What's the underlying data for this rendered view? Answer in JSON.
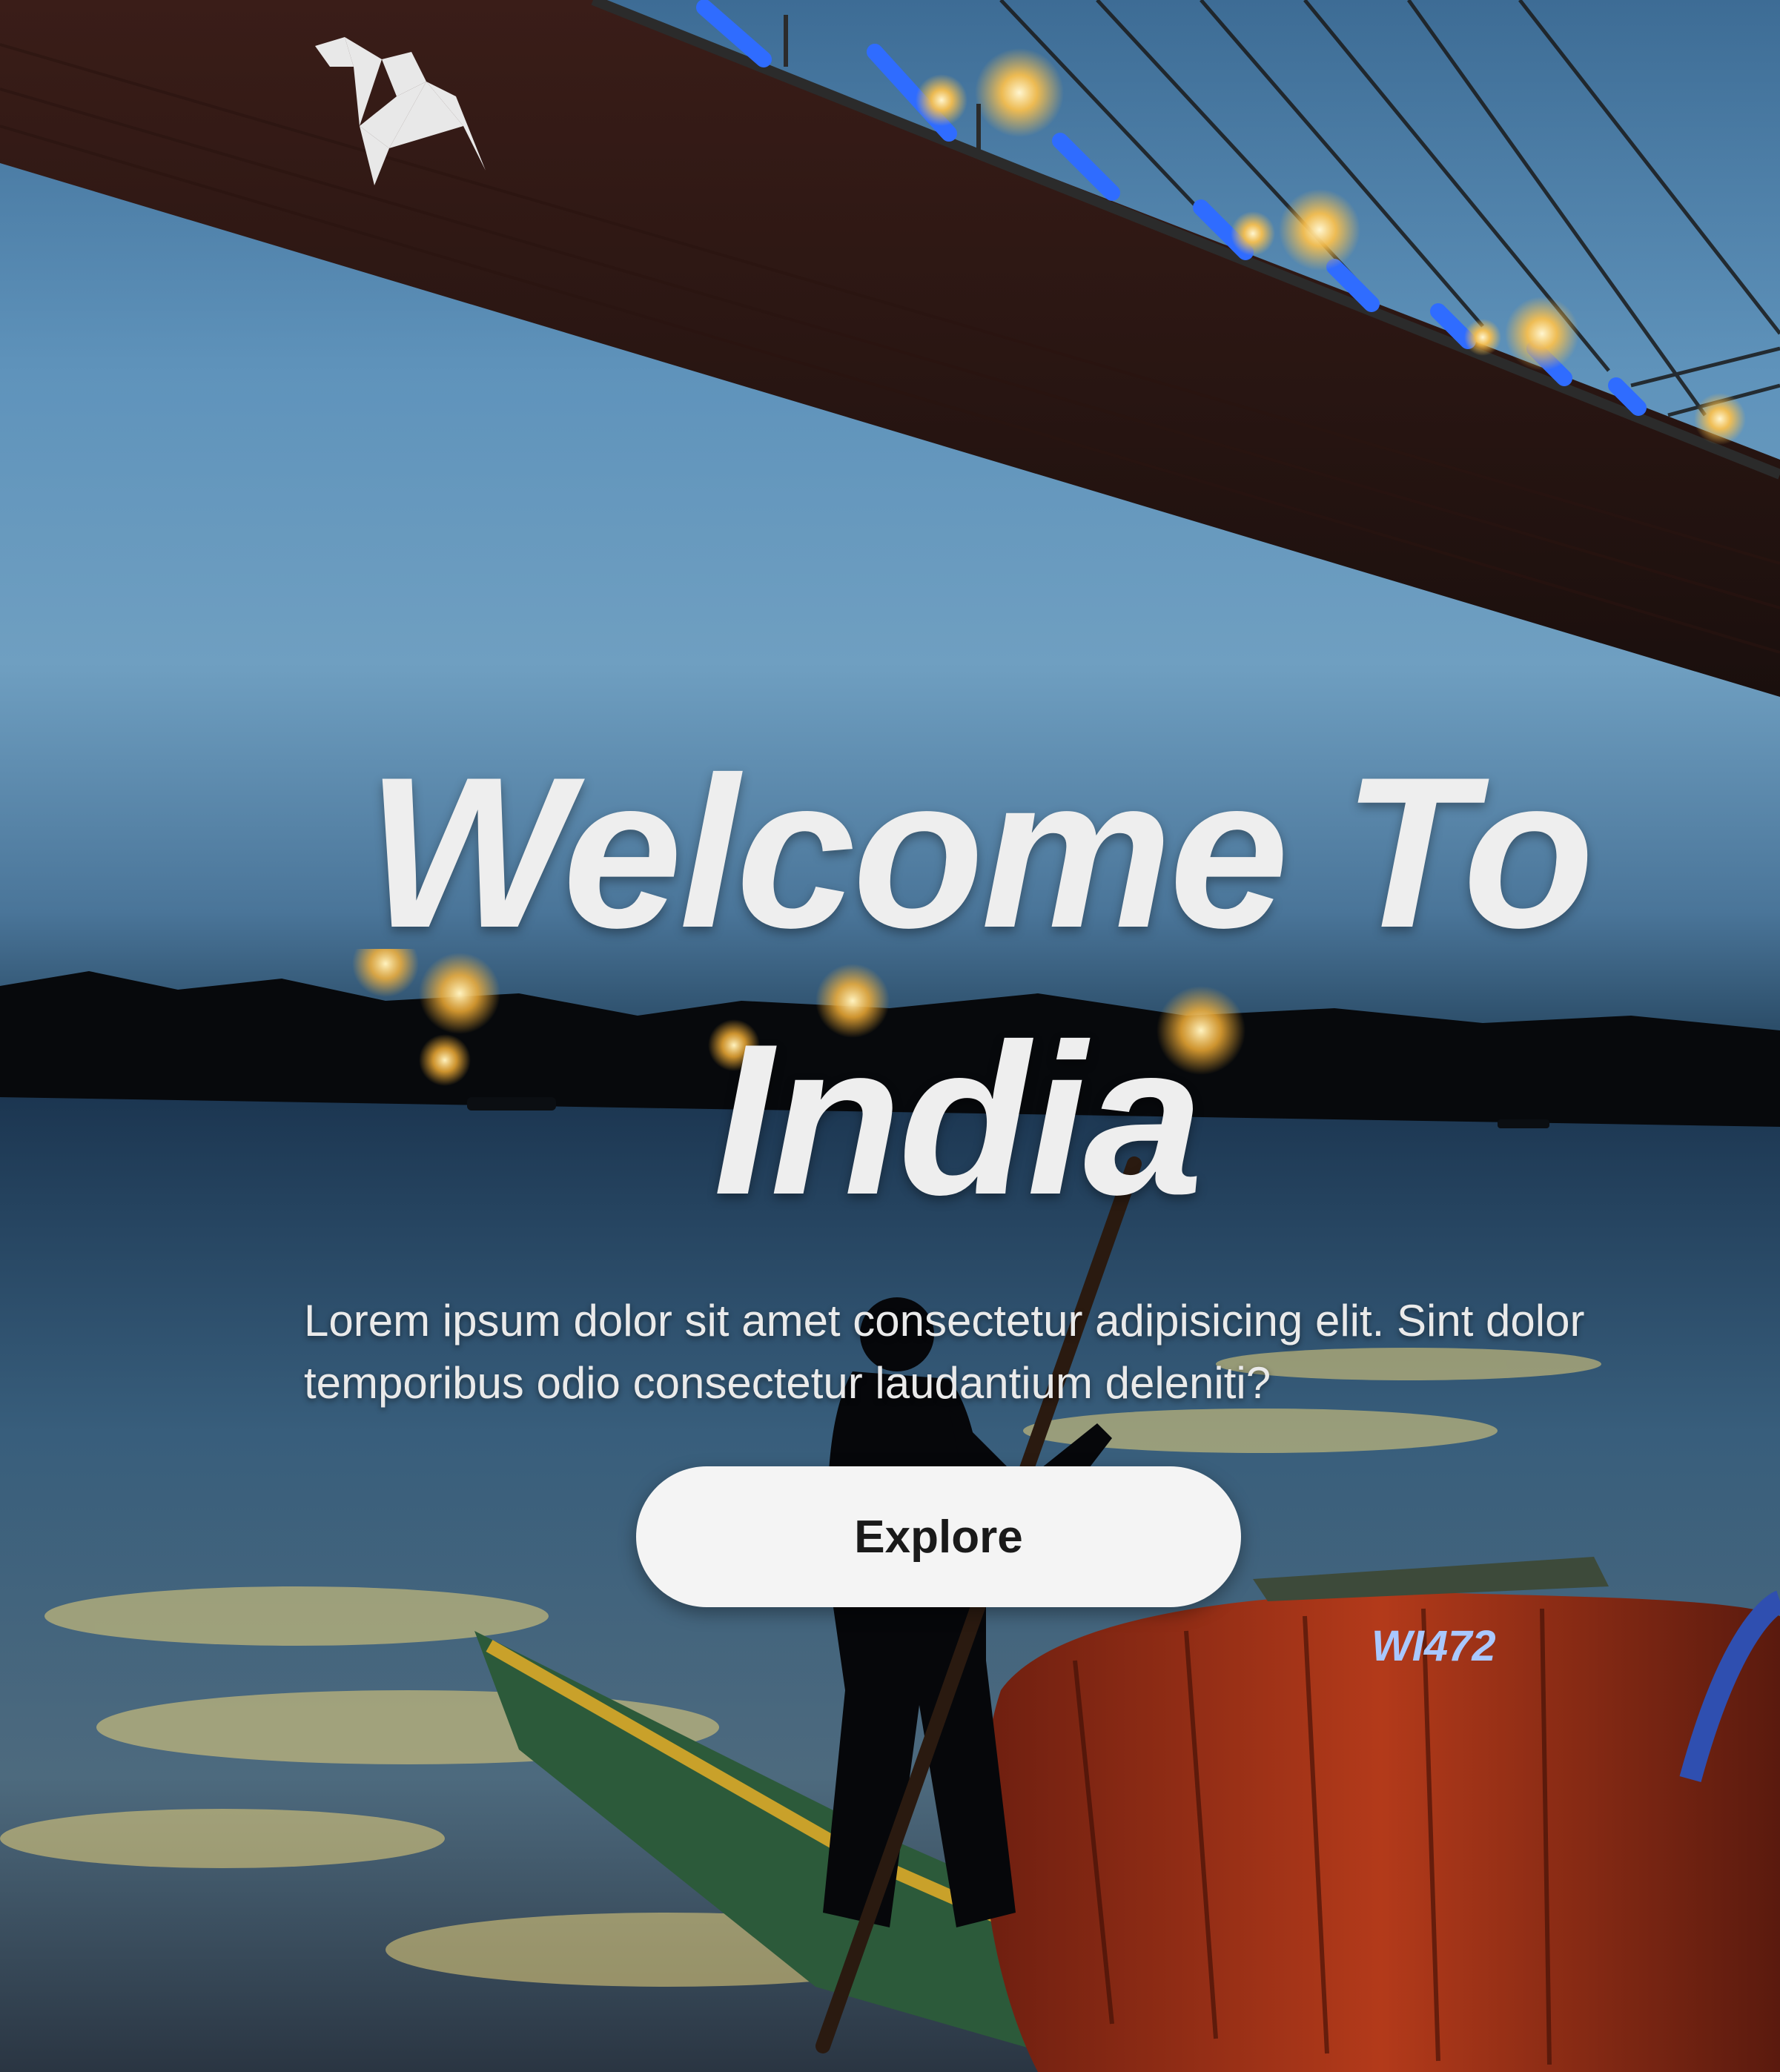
{
  "logo": {
    "icon": "origami-bird-logo-icon"
  },
  "hero": {
    "headline_line1": "Welcome To",
    "headline_line2": "India",
    "subtitle": "Lorem ipsum dolor sit amet consectetur adipisicing elit. Sint dolor temporibus odio consectetur laudantium deleniti?",
    "cta_label": "Explore"
  },
  "background": {
    "boat_marking": "WI472"
  },
  "colors": {
    "text": "#eeeeee",
    "button_bg": "#f4f4f4",
    "button_text": "#1a1a1a",
    "bridge_light_blue": "#2f6cff",
    "lamp_glow": "#ffc24a"
  }
}
